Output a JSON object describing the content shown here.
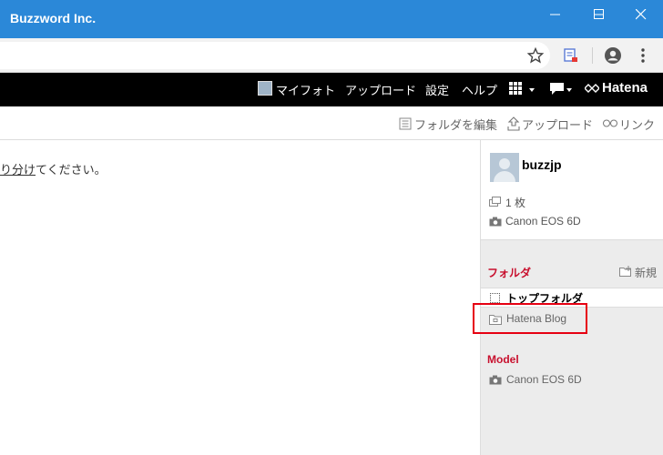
{
  "window": {
    "title": "Buzzword Inc."
  },
  "navbar": {
    "items": [
      "マイフォト",
      "アップロード",
      "設定",
      "ヘルプ"
    ],
    "brand": "Hatena"
  },
  "toolbar": {
    "edit_folder": "フォルダを編集",
    "upload": "アップロード",
    "link": "リンク"
  },
  "main": {
    "text_link": "り分け",
    "text_rest": "てください。"
  },
  "sidebar": {
    "username": "buzzjp",
    "photo_count": "1 枚",
    "camera": "Canon EOS 6D",
    "folder_heading": "フォルダ",
    "new_label": "新規",
    "top_folder": "トップフォルダ",
    "folders": [
      "Hatena Blog"
    ],
    "model_heading": "Model",
    "models": [
      "Canon EOS 6D"
    ]
  },
  "colors": {
    "titlebar": "#2b88d8",
    "navbar": "#000000",
    "accent_red": "#c8102e",
    "highlight": "#e60012"
  },
  "icons": [
    "star-icon",
    "extension-icon",
    "account-icon",
    "kebab-menu-icon",
    "apps-grid-icon",
    "comment-icon",
    "hatena-logo-icon",
    "folder-edit-icon",
    "upload-icon",
    "link-icon",
    "photos-icon",
    "camera-icon",
    "new-folder-icon",
    "folder-icon"
  ]
}
